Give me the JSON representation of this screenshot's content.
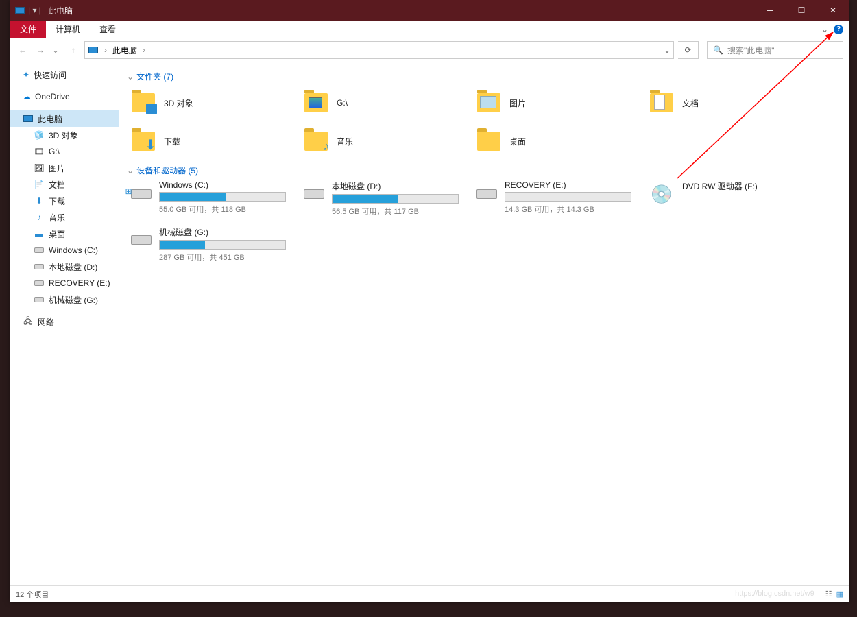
{
  "title": "此电脑",
  "ribbon": {
    "file": "文件",
    "computer": "计算机",
    "view": "查看"
  },
  "nav": {
    "location": "此电脑",
    "search_placeholder": "搜索\"此电脑\""
  },
  "sidebar": {
    "quick": "快速访问",
    "onedrive": "OneDrive",
    "thispc": "此电脑",
    "sub": [
      "3D 对象",
      "G:\\",
      "图片",
      "文档",
      "下载",
      "音乐",
      "桌面",
      "Windows (C:)",
      "本地磁盘 (D:)",
      "RECOVERY (E:)",
      "机械磁盘 (G:)"
    ],
    "network": "网络"
  },
  "groups": {
    "folders_header": "文件夹 (7)",
    "drives_header": "设备和驱动器 (5)"
  },
  "folders": [
    {
      "label": "3D 对象"
    },
    {
      "label": "G:\\"
    },
    {
      "label": "图片"
    },
    {
      "label": "文档"
    },
    {
      "label": "下载"
    },
    {
      "label": "音乐"
    },
    {
      "label": "桌面"
    }
  ],
  "drives": [
    {
      "name": "Windows (C:)",
      "stat": "55.0 GB 可用，共 118 GB",
      "fill": 53
    },
    {
      "name": "本地磁盘 (D:)",
      "stat": "56.5 GB 可用，共 117 GB",
      "fill": 52
    },
    {
      "name": "RECOVERY (E:)",
      "stat": "14.3 GB 可用，共 14.3 GB",
      "fill": 0
    },
    {
      "name": "DVD RW 驱动器 (F:)",
      "stat": "",
      "fill": -1
    },
    {
      "name": "机械磁盘 (G:)",
      "stat": "287 GB 可用，共 451 GB",
      "fill": 36
    }
  ],
  "status": "12 个项目",
  "watermark": "https://blog.csdn.net/w9"
}
